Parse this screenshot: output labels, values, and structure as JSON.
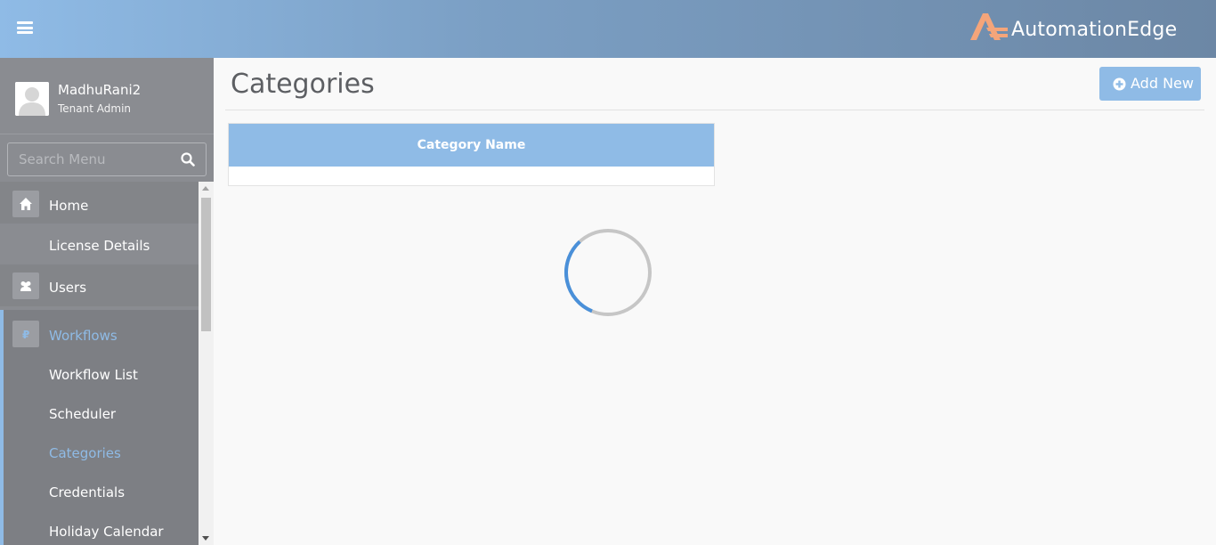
{
  "header": {
    "logo_text": "AutomationEdge",
    "colors": {
      "brand_accent": "#f5a57a",
      "header_start": "#8fbbe6",
      "header_end": "#6c87a5"
    }
  },
  "user": {
    "name": "MadhuRani2",
    "role": "Tenant Admin"
  },
  "search": {
    "placeholder": "Search Menu"
  },
  "menu": {
    "items": [
      {
        "label": "Home",
        "icon": "home-icon"
      },
      {
        "label": "License Details"
      },
      {
        "label": "Users",
        "icon": "users-icon"
      },
      {
        "label": "Workflows",
        "icon": "workflow-icon"
      },
      {
        "label": "Workflow List"
      },
      {
        "label": "Scheduler"
      },
      {
        "label": "Categories"
      },
      {
        "label": "Credentials"
      },
      {
        "label": "Holiday Calendar"
      }
    ]
  },
  "main": {
    "title": "Categories",
    "add_button": "Add New",
    "table": {
      "columns": [
        "Category Name"
      ],
      "rows": []
    }
  }
}
